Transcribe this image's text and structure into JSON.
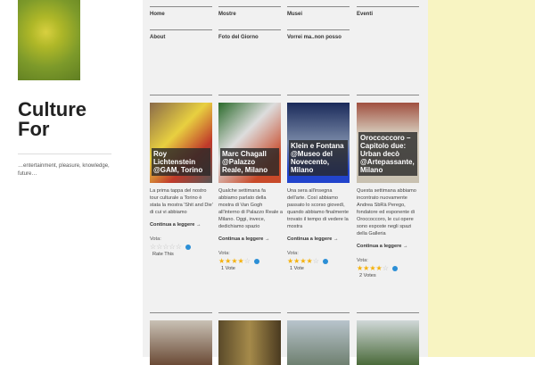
{
  "site": {
    "title": "Culture For",
    "tagline": "…entertainment, pleasure, knowledge, future…"
  },
  "nav": [
    "Home",
    "Mostre",
    "Musei",
    "Eventi",
    "About",
    "Foto del Giorno",
    "Vorrei ma..non posso"
  ],
  "posts": [
    {
      "title": "Roy Lichtenstein @GAM, Torino",
      "excerpt": "La prima tappa del nostro tour culturale a Torino è stata la mostra 'Shit and Die' di cui vi abbiamo",
      "more": "Continua a leggere →",
      "vote_label": "Vota:",
      "rating": 0,
      "votes": "Rate This"
    },
    {
      "title": "Marc Chagall @Palazzo Reale, Milano",
      "excerpt": "Qualche settimana fa abbiamo parlato della mostra di Van Gogh all'interno di Palazzo Reale a Milano. Oggi, invece, dedichiamo spazio",
      "more": "Continua a leggere →",
      "vote_label": "Vota:",
      "rating": 4,
      "votes": "1 Vote"
    },
    {
      "title": "Klein e Fontana @Museo del Novecento, Milano",
      "excerpt": "Una sera all'insegna dell'arte. Così abbiamo passato lo scorso giovedì, quando abbiamo finalmente trovato il tempo di vedere la mostra",
      "more": "Continua a leggere →",
      "vote_label": "Vota:",
      "rating": 4,
      "votes": "1 Vote"
    },
    {
      "title": "Oroccoccoro – Capitolo due: Urban decò @Artepassante, Milano",
      "excerpt": "Questa settimana abbiamo incontrato nuovamente Andrea SbRà Perego, fondatore ed esponente di Oroccoccoro, le cui opere sono esposte negli spazi della Galleria",
      "more": "Continua a leggere →",
      "vote_label": "Vota:",
      "rating": 4,
      "votes": "2 Votes"
    }
  ],
  "colors": {
    "main_bg": "#f1f1f1",
    "right_bg": "#f8f4c2",
    "star": "#f5b10a"
  }
}
